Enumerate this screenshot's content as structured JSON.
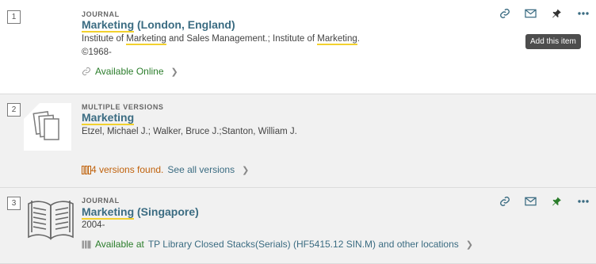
{
  "results": [
    {
      "number": "1",
      "type": "JOURNAL",
      "title_highlight": "Marketing",
      "title_rest": " (London, England)",
      "line1_parts": [
        "Institute of ",
        "Marketing",
        " and Sales Management.; Institute of ",
        "Marketing",
        "."
      ],
      "line2": "©1968-",
      "availability": "Available Online",
      "tooltip": "Add this item"
    },
    {
      "number": "2",
      "type": "MULTIPLE VERSIONS",
      "title_highlight": "Marketing",
      "authors": "Etzel, Michael J.; Walker, Bruce J.;Stanton, William J.",
      "versions_text": "4 versions found.",
      "see_all": "See all versions"
    },
    {
      "number": "3",
      "type": "JOURNAL",
      "title_highlight": "Marketing",
      "title_rest": " (Singapore)",
      "line1": "2004-",
      "availability_status": "Available at",
      "availability_location": "TP Library  Closed Stacks(Serials) (HF5415.12 SIN.M) and other locations"
    }
  ],
  "icons": {
    "link": "link-icon",
    "email": "email-icon",
    "pin": "pin-icon",
    "more": "more-icon"
  },
  "colors": {
    "title": "#3b6c82",
    "highlight": "#f2d12e",
    "available": "#2b7d2b",
    "versions": "#c0620c",
    "pinned": "#2b7d2b"
  }
}
